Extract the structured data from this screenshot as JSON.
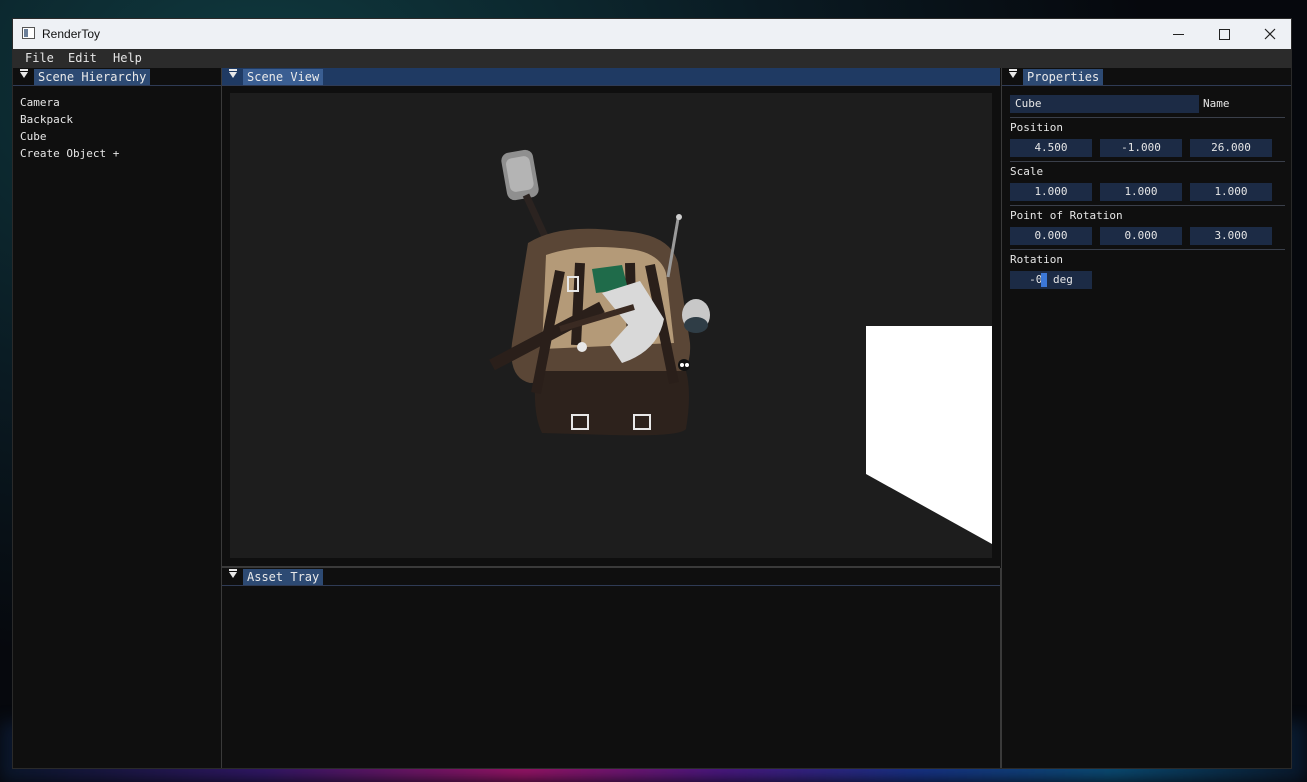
{
  "window": {
    "title": "RenderToy",
    "controls": {
      "minimize": "minimize",
      "maximize": "maximize",
      "close": "close"
    }
  },
  "menu": [
    "File",
    "Edit",
    "Help"
  ],
  "hierarchy": {
    "tab": "Scene Hierarchy",
    "items": [
      "Camera",
      "Backpack",
      "Cube",
      "Create Object +"
    ]
  },
  "scene_view": {
    "tab": "Scene View"
  },
  "asset_tray": {
    "tab": "Asset Tray"
  },
  "properties": {
    "tab": "Properties",
    "name_value": "Cube",
    "name_label": "Name",
    "position": {
      "label": "Position",
      "x": "4.500",
      "y": "-1.000",
      "z": "26.000"
    },
    "scale": {
      "label": "Scale",
      "x": "1.000",
      "y": "1.000",
      "z": "1.000"
    },
    "point_of_rotation": {
      "label": "Point of Rotation",
      "x": "0.000",
      "y": "0.000",
      "z": "3.000"
    },
    "rotation": {
      "label": "Rotation",
      "value_pre": "-0",
      "value_post": " deg"
    }
  },
  "colors": {
    "accent": "#3a5e92",
    "field_bg": "#1c2b45",
    "panel_bg": "#0f0f0f",
    "viewport_bg": "#1d1d1d"
  }
}
